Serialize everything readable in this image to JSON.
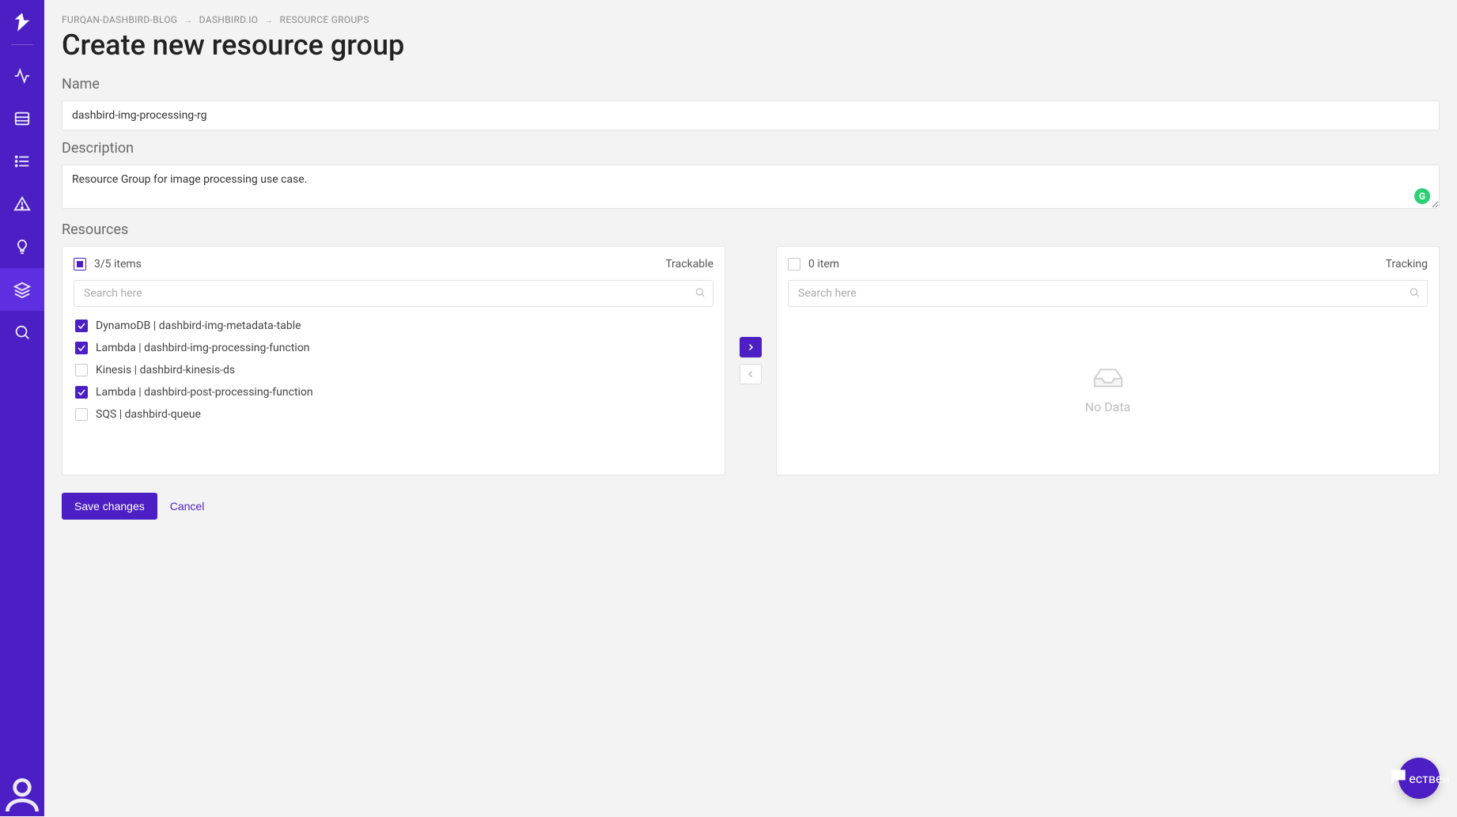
{
  "breadcrumb": {
    "item1": "FURQAN-DASHBIRD-BLOG",
    "item2": "DASHBIRD.IO",
    "item3": "RESOURCE GROUPS"
  },
  "page": {
    "title": "Create new resource group"
  },
  "form": {
    "name_label": "Name",
    "name_value": "dashbird-img-processing-rg",
    "description_label": "Description",
    "description_value": "Resource Group for image processing use case.",
    "resources_label": "Resources"
  },
  "transfer": {
    "left": {
      "selected_count_label": "3/5 items",
      "header_right": "Trackable",
      "search_placeholder": "Search here",
      "items": [
        {
          "label": "DynamoDB | dashbird-img-metadata-table",
          "checked": true
        },
        {
          "label": "Lambda | dashbird-img-processing-function",
          "checked": true
        },
        {
          "label": "Kinesis | dashbird-kinesis-ds",
          "checked": false
        },
        {
          "label": "Lambda | dashbird-post-processing-function",
          "checked": true
        },
        {
          "label": "SQS | dashbird-queue",
          "checked": false
        }
      ]
    },
    "right": {
      "count_label": "0 item",
      "header_right": "Tracking",
      "search_placeholder": "Search here",
      "no_data_label": "No Data"
    }
  },
  "actions": {
    "save_label": "Save changes",
    "cancel_label": "Cancel"
  },
  "grammarly_glyph": "G",
  "sidebar": {
    "active_index": 5
  }
}
